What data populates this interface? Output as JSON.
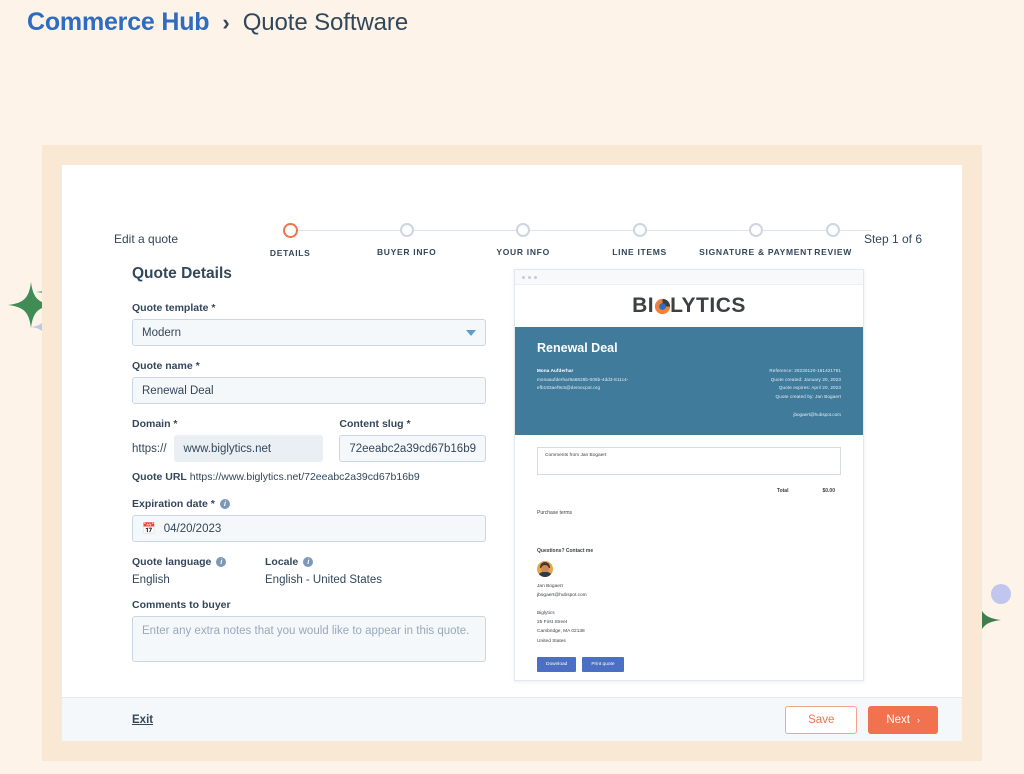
{
  "breadcrumb": {
    "primary": "Commerce Hub",
    "separator": "›",
    "secondary": "Quote Software"
  },
  "wizard": {
    "edit_label": "Edit a quote",
    "step_counter": "Step 1 of 6",
    "steps": [
      {
        "label": "DETAILS",
        "active": true
      },
      {
        "label": "BUYER INFO",
        "active": false
      },
      {
        "label": "YOUR INFO",
        "active": false
      },
      {
        "label": "LINE ITEMS",
        "active": false
      },
      {
        "label": "SIGNATURE & PAYMENT",
        "active": false
      },
      {
        "label": "REVIEW",
        "active": false
      }
    ]
  },
  "form": {
    "section_title": "Quote Details",
    "quote_template": {
      "label": "Quote template *",
      "value": "Modern",
      "icon": "chevron-down-icon"
    },
    "quote_name": {
      "label": "Quote name *",
      "value": "Renewal Deal"
    },
    "domain": {
      "label": "Domain *",
      "prefix": "https://",
      "value": "www.biglytics.net"
    },
    "content_slug": {
      "label": "Content slug *",
      "value": "72eeabc2a39cd67b16b9"
    },
    "quote_url": {
      "label": "Quote URL",
      "value": "https://www.biglytics.net/72eeabc2a39cd67b16b9"
    },
    "expiration_date": {
      "label": "Expiration date *",
      "value": "04/20/2023",
      "icon": "calendar-icon",
      "info_icon": "info-icon"
    },
    "quote_language": {
      "label": "Quote language",
      "value": "English",
      "info_icon": "info-icon"
    },
    "locale": {
      "label": "Locale",
      "value": "English - United States",
      "info_icon": "info-icon"
    },
    "comments_to_buyer": {
      "label": "Comments to buyer",
      "placeholder": "Enter any extra notes that you would like to appear in this quote."
    }
  },
  "preview": {
    "logo": {
      "before": "BI",
      "mark": "biglytics-logo-mark",
      "after": "LYTICS"
    },
    "hero": {
      "title": "Renewal Deal",
      "buyer_name": "Mona Aufderhar",
      "buyer_id": "monaaufderhar9a6826b-005b-4dd3-811c4-",
      "buyer_email": "efb183aef9c5@democpot.org",
      "reference": "Reference: 20230120-161421781",
      "created": "Quote created: January 20, 2023",
      "expires": "Quote expires: April 20, 2023",
      "created_by": "Quote created by: Jan Bogaert",
      "sender_email": "jbogaert@hubspot.com",
      "bg_color": "#417b9b"
    },
    "comment_box": "Comments from Jan Bogaert",
    "total_label": "Total",
    "total_value": "$0.00",
    "purchase_terms": "Purchase terms",
    "questions": "Questions? Contact me",
    "contact": {
      "name": "Jan Bogaert",
      "email": "jbogaert@hubspot.com",
      "company": "Biglytics",
      "street": "25 First Street",
      "city": "Cambridge, MA 02138",
      "country": "United States"
    },
    "buttons": [
      {
        "label": "Download"
      },
      {
        "label": "Print quote"
      }
    ]
  },
  "footer": {
    "exit": "Exit",
    "save": "Save",
    "next": "Next",
    "next_chevron": "›"
  },
  "colors": {
    "page_bg": "#fdf3e8",
    "frame": "#f8e8d4",
    "brand_blue": "#2d6cbf",
    "accent_orange": "#f2714e",
    "text_dark": "#33475b",
    "preview_blue": "#417b9b",
    "sparkle_green_light": "#6eb77f",
    "sparkle_green_dark": "#3f8c55",
    "sparkle_periwinkle": "#c0c6ee"
  }
}
